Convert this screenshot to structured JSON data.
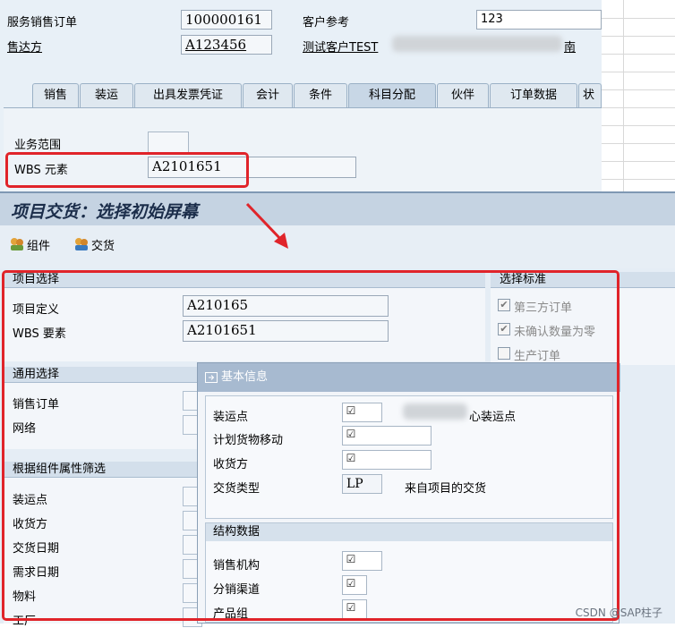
{
  "header": {
    "order_label": "服务销售订单",
    "order_value": "100000161",
    "customer_ref_label": "客户参考",
    "customer_ref_value": "123",
    "sold_to_label": "售达方",
    "sold_to_value": "A123456",
    "sold_to_name": "测试客户TEST",
    "sold_to_suffix": "南"
  },
  "tabs": [
    "销售",
    "装运",
    "出具发票凭证",
    "会计",
    "条件",
    "科目分配",
    "伙伴",
    "订单数据",
    "状态"
  ],
  "active_tab": "科目分配",
  "account_panel": {
    "business_area_label": "业务范围",
    "wbs_label": "WBS 元素",
    "wbs_value": "A2101651"
  },
  "screen_title": "项目交货：选择初始屏幕",
  "toolbar": {
    "components_label": "组件",
    "delivery_label": "交货"
  },
  "project_selection": {
    "title": "项目选择",
    "project_def_label": "项目定义",
    "project_def_value": "A210165",
    "wbs_label": "WBS 要素",
    "wbs_value": "A2101651"
  },
  "selection_criteria": {
    "title": "选择标准",
    "third_party_label": "第三方订单",
    "unconfirmed_label": "未确认数量为零",
    "production_label": "生产订单",
    "third_party_checked": true,
    "unconfirmed_checked": true,
    "production_checked": false
  },
  "general_selection": {
    "title": "通用选择",
    "sales_order_label": "销售订单",
    "network_label": "网络"
  },
  "component_filter": {
    "title": "根据组件属性筛选",
    "shipping_point_label": "装运点",
    "ship_to_label": "收货方",
    "delivery_date_label": "交货日期",
    "req_date_label": "需求日期",
    "material_label": "物料",
    "plant_label": "工厂"
  },
  "dialog": {
    "title": "基本信息",
    "basic": {
      "shipping_point_label": "装运点",
      "shipping_point_suffix": "心装运点",
      "planned_gm_label": "计划货物移动",
      "ship_to_label": "收货方",
      "delivery_type_label": "交货类型",
      "delivery_type_value": "LP",
      "delivery_type_desc": "来自项目的交货"
    },
    "structure": {
      "title": "结构数据",
      "sales_org_label": "销售机构",
      "dist_channel_label": "分销渠道",
      "product_group_label": "产品组"
    }
  },
  "watermark": "CSDN @SAP柱子",
  "colors": {
    "highlight_border": "#e0242a",
    "arrow": "#e0242a"
  }
}
